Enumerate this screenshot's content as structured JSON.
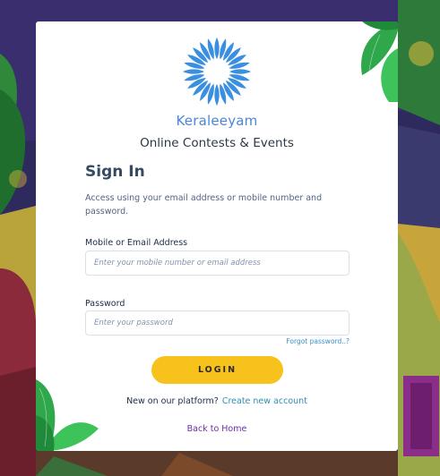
{
  "brand": {
    "name": "Keraleeyam",
    "tagline": "Online Contests & Events",
    "logo": "sun-ray-logo",
    "color": "#4a86d8"
  },
  "signin": {
    "title": "Sign In",
    "description": "Access using your email address or mobile number and password.",
    "email_label": "Mobile or Email Address",
    "email_placeholder": "Enter your mobile number or email address",
    "email_value": "",
    "password_label": "Password",
    "password_placeholder": "Enter your password",
    "password_value": "",
    "forgot_label": "Forgot password..?",
    "login_label": "LOGIN",
    "login_color": "#f7c21b"
  },
  "footer": {
    "signup_prompt": "New on our platform?",
    "signup_link": "Create new account",
    "back_home": "Back to Home"
  }
}
